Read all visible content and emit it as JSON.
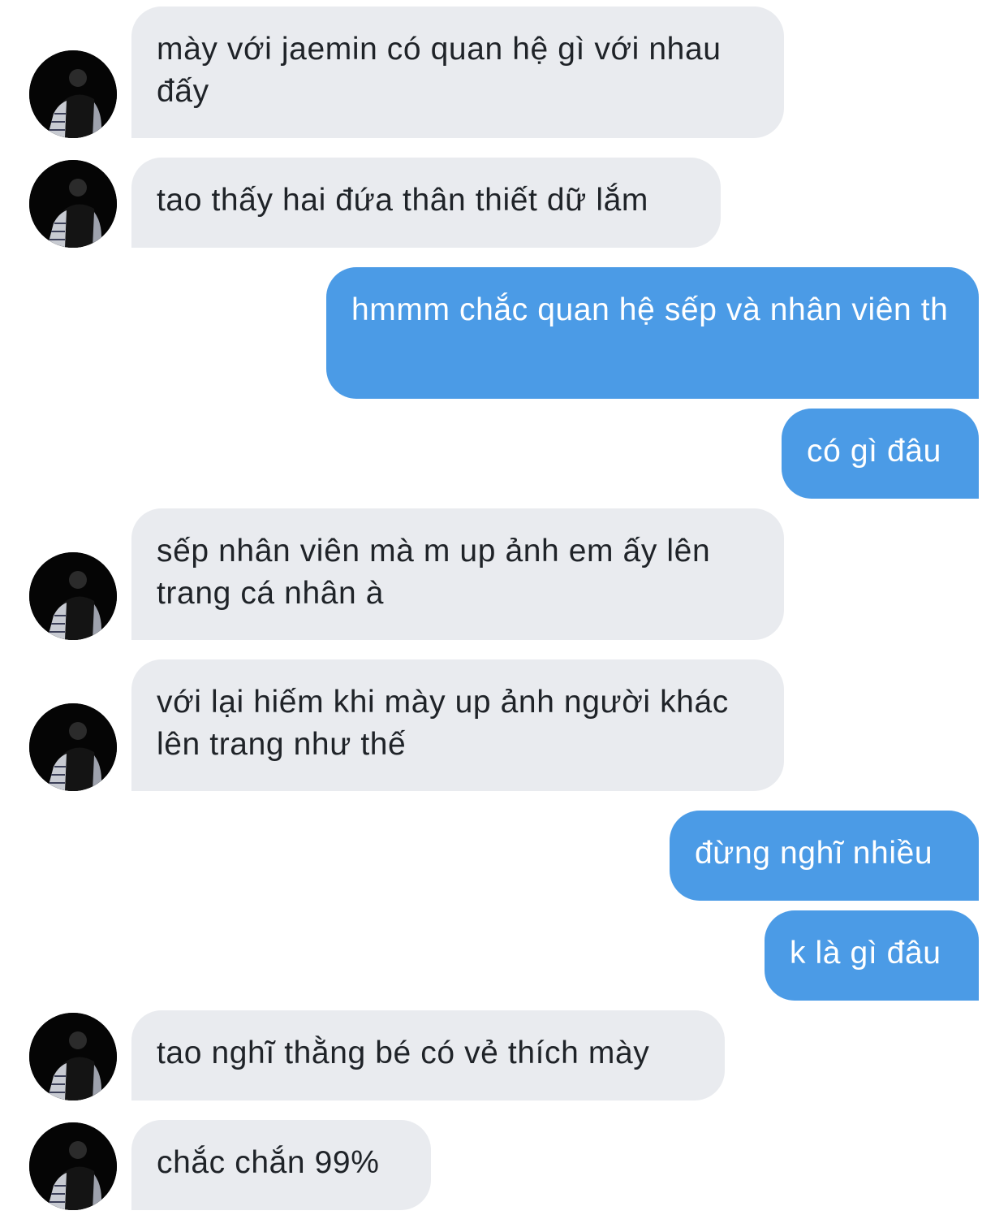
{
  "conversation": {
    "messages": [
      {
        "sender": "them",
        "text": "mày với jaemin có quan hệ gì với nhau đấy"
      },
      {
        "sender": "them",
        "text": "tao thấy hai đứa thân thiết dữ lắm"
      },
      {
        "sender": "me",
        "text": "hmmm chắc quan hệ sếp và nhân viên th"
      },
      {
        "sender": "me",
        "text": "có gì đâu"
      },
      {
        "sender": "them",
        "text": "sếp nhân viên mà m up ảnh em ấy lên trang cá nhân à"
      },
      {
        "sender": "them",
        "text": "với lại hiếm khi mày up ảnh người khác lên trang như thế"
      },
      {
        "sender": "me",
        "text": "đừng nghĩ nhiều"
      },
      {
        "sender": "me",
        "text": "k là gì đâu"
      },
      {
        "sender": "them",
        "text": "tao nghĩ thằng bé có vẻ thích mày"
      },
      {
        "sender": "them",
        "text": "chắc chắn 99%"
      }
    ]
  },
  "colors": {
    "incoming_bubble": "#e9ebef",
    "incoming_text": "#1f2328",
    "outgoing_bubble": "#4b9be6",
    "outgoing_text": "#ffffff"
  },
  "icons": {
    "avatar": "contact-avatar-icon"
  }
}
